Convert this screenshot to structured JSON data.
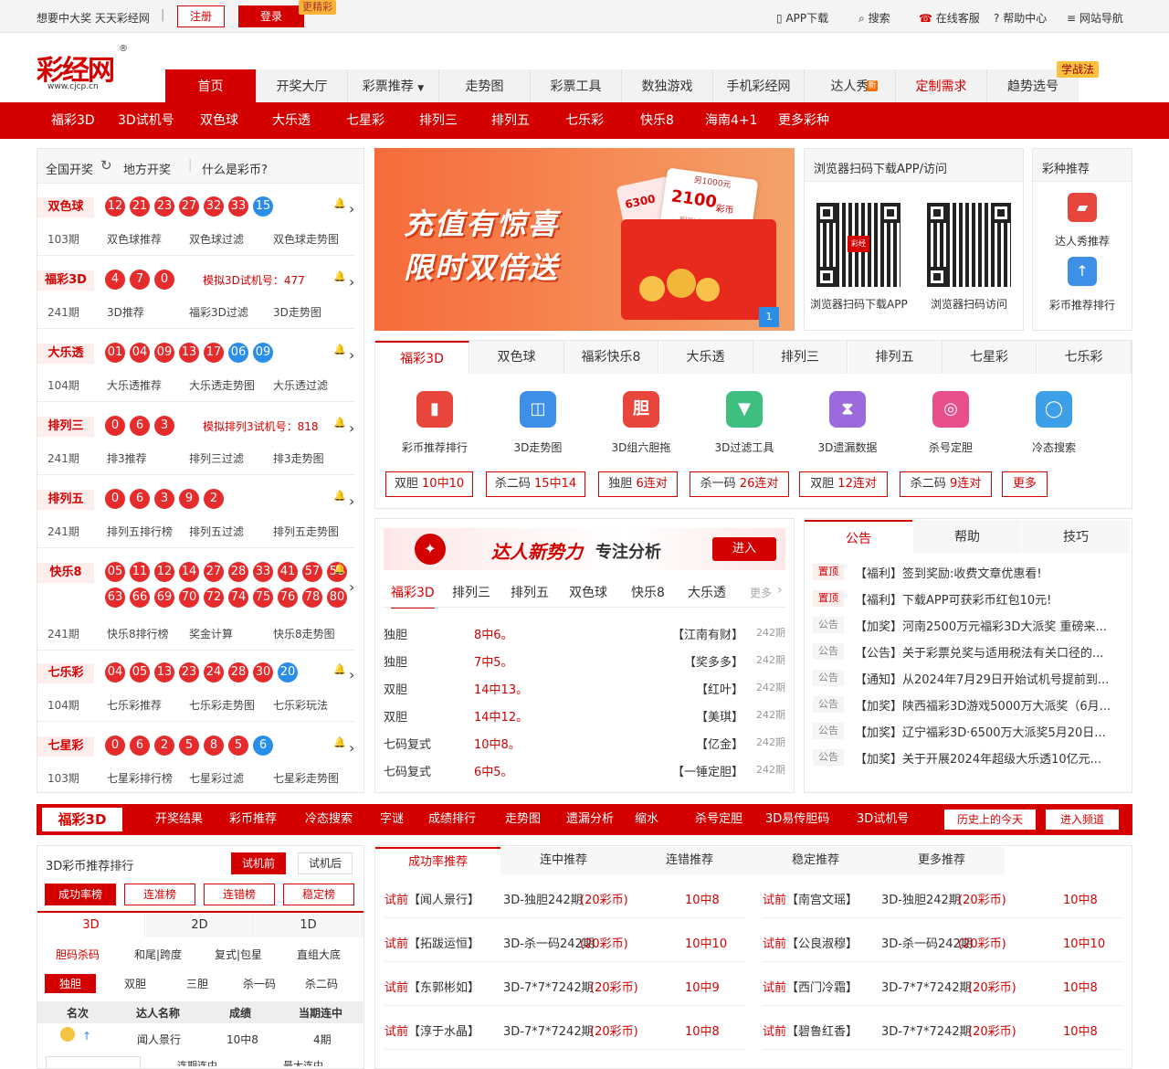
{
  "topbar": {
    "slogan": "想要中大奖 天天彩经网",
    "sep": "|",
    "register": "注册",
    "login": "登录",
    "login_tag": "更精彩",
    "links": [
      {
        "label": "APP下载",
        "icon": "phone-icon"
      },
      {
        "label": "搜索",
        "icon": "search-icon"
      },
      {
        "label": "在线客服",
        "icon": "service-icon"
      },
      {
        "label": "帮助中心",
        "icon": "help-icon"
      },
      {
        "label": "网站导航",
        "icon": "menu-icon"
      }
    ]
  },
  "logo": {
    "main": "彩经网",
    "url": "www.cjcp.cn",
    "reg": "®"
  },
  "main_nav": {
    "items": [
      "首页",
      "开奖大厅",
      "彩票推荐",
      "走势图",
      "彩票工具",
      "数独游戏",
      "手机彩经网",
      "达人秀",
      "定制需求",
      "趋势选号"
    ],
    "hot_badge": "新",
    "study_tag": "学战法"
  },
  "sub_nav": [
    "福彩3D",
    "3D试机号",
    "双色球",
    "大乐透",
    "七星彩",
    "排列三",
    "排列五",
    "七乐彩",
    "快乐8",
    "海南4+1",
    "更多彩种"
  ],
  "draw_panel": {
    "tabs": [
      "全国开奖",
      "地方开奖",
      "什么是彩币?"
    ],
    "rows": [
      {
        "name": "双色球",
        "balls": [
          "12",
          "21",
          "23",
          "27",
          "32",
          "33"
        ],
        "blue": [
          "15"
        ],
        "issue": "103期",
        "links": [
          "双色球推荐",
          "双色球过滤",
          "双色球走势图"
        ]
      },
      {
        "name": "福彩3D",
        "balls": [
          "4",
          "7",
          "0"
        ],
        "blue": [],
        "shiji": "模拟3D试机号：477",
        "issue": "241期",
        "links": [
          "3D推荐",
          "福彩3D过滤",
          "3D走势图"
        ]
      },
      {
        "name": "大乐透",
        "balls": [
          "01",
          "04",
          "09",
          "13",
          "17"
        ],
        "blue": [
          "06",
          "09"
        ],
        "issue": "104期",
        "links": [
          "大乐透推荐",
          "大乐透走势图",
          "大乐透过滤"
        ]
      },
      {
        "name": "排列三",
        "balls": [
          "0",
          "6",
          "3"
        ],
        "blue": [],
        "shiji": "模拟排列3试机号：818",
        "issue": "241期",
        "links": [
          "排3推荐",
          "排列三过滤",
          "排3走势图"
        ]
      },
      {
        "name": "排列五",
        "balls": [
          "0",
          "6",
          "3",
          "9",
          "2"
        ],
        "blue": [],
        "issue": "241期",
        "links": [
          "排列五排行榜",
          "排列五过滤",
          "排列五走势图"
        ]
      },
      {
        "name": "快乐8",
        "balls": [
          "05",
          "11",
          "12",
          "14",
          "27",
          "28",
          "33",
          "41",
          "57",
          "58",
          "63",
          "66",
          "69",
          "70",
          "72",
          "74",
          "75",
          "76",
          "78",
          "80"
        ],
        "blue": [],
        "issue": "241期",
        "links": [
          "快乐8排行榜",
          "奖金计算",
          "快乐8走势图"
        ]
      },
      {
        "name": "七乐彩",
        "balls": [
          "04",
          "05",
          "13",
          "23",
          "24",
          "28",
          "30"
        ],
        "blue": [
          "20"
        ],
        "issue": "104期",
        "links": [
          "七乐彩推荐",
          "七乐彩走势图",
          "七乐彩玩法"
        ]
      },
      {
        "name": "七星彩",
        "balls": [
          "0",
          "6",
          "2",
          "5",
          "8",
          "5"
        ],
        "blue": [
          "6"
        ],
        "issue": "103期",
        "links": [
          "七星彩排行榜",
          "七星彩过滤",
          "七星彩走势图"
        ]
      }
    ]
  },
  "banner": {
    "line1": "充值有惊喜",
    "line2": "限时双倍送",
    "card_big": "2100",
    "card_big_unit": "彩币",
    "card_small": "6300",
    "card_top": "另1000元",
    "card_note": "到账金额",
    "page": "1"
  },
  "qr_panel": {
    "title": "浏览器扫码下载APP/访问",
    "captions": [
      "浏览器扫码下载APP",
      "浏览器扫码访问"
    ],
    "qr_badge": "彩经"
  },
  "rec_panel": {
    "title": "彩种推荐",
    "items": [
      "达人秀推荐",
      "彩币推荐排行"
    ]
  },
  "tools": {
    "tabs": [
      "福彩3D",
      "双色球",
      "福彩快乐8",
      "大乐透",
      "排列三",
      "排列五",
      "七星彩",
      "七乐彩"
    ],
    "icons": [
      {
        "label": "彩币推荐排行",
        "glyph": "▮",
        "color": "#e8453c"
      },
      {
        "label": "3D走势图",
        "glyph": "◫",
        "color": "#3d8fe8"
      },
      {
        "label": "3D组六胆拖",
        "glyph": "胆",
        "color": "#e8453c"
      },
      {
        "label": "3D过滤工具",
        "glyph": "▼",
        "color": "#3fbf7f"
      },
      {
        "label": "3D遗漏数据",
        "glyph": "⧗",
        "color": "#9b6bde"
      },
      {
        "label": "杀号定胆",
        "glyph": "◎",
        "color": "#e84e8a"
      },
      {
        "label": "冷态搜索",
        "glyph": "◯",
        "color": "#3d9fe8"
      }
    ],
    "buttons": [
      {
        "k": "双胆",
        "v": "10中10"
      },
      {
        "k": "杀二码",
        "v": "15中14"
      },
      {
        "k": "独胆",
        "v": "6连对"
      },
      {
        "k": "杀一码",
        "v": "26连对"
      },
      {
        "k": "双胆",
        "v": "12连对"
      },
      {
        "k": "杀二码",
        "v": "9连对"
      },
      {
        "k": "更多",
        "v": ""
      }
    ]
  },
  "expert": {
    "slogan1": "达人新势力",
    "slogan2": "专注分析",
    "enter": "进入",
    "tabs": [
      "福彩3D",
      "排列三",
      "排列五",
      "双色球",
      "快乐8",
      "大乐透",
      "更多"
    ],
    "rows": [
      {
        "type": "独胆",
        "result": "8中6。",
        "name": "【江南有财】",
        "issue": "242期"
      },
      {
        "type": "独胆",
        "result": "7中5。",
        "name": "【奖多多】",
        "issue": "242期"
      },
      {
        "type": "双胆",
        "result": "14中13。",
        "name": "【红叶】",
        "issue": "242期"
      },
      {
        "type": "双胆",
        "result": "14中12。",
        "name": "【美琪】",
        "issue": "242期"
      },
      {
        "type": "七码复式",
        "result": "10中8。",
        "name": "【亿金】",
        "issue": "242期"
      },
      {
        "type": "七码复式",
        "result": "6中5。",
        "name": "【一锤定胆】",
        "issue": "242期"
      }
    ]
  },
  "notice": {
    "tabs": [
      "公告",
      "帮助",
      "技巧"
    ],
    "rows": [
      {
        "tag": "置顶",
        "text": "【福利】签到奖励:收费文章优惠看!"
      },
      {
        "tag": "置顶",
        "text": "【福利】下载APP可获彩币红包10元!"
      },
      {
        "tag": "公告",
        "text": "【加奖】河南2500万元福彩3D大派奖 重磅来..."
      },
      {
        "tag": "公告",
        "text": "【公告】关于彩票兑奖与适用税法有关口径的..."
      },
      {
        "tag": "公告",
        "text": "【通知】从2024年7月29日开始试机号提前到..."
      },
      {
        "tag": "公告",
        "text": "【加奖】陕西福彩3D游戏5000万大派奖（6月..."
      },
      {
        "tag": "公告",
        "text": "【加奖】辽宁福彩3D·6500万大派奖5月20日..."
      },
      {
        "tag": "公告",
        "text": "【加奖】关于开展2024年超级大乐透10亿元..."
      }
    ]
  },
  "bar3d": {
    "label": "福彩3D",
    "links": [
      "开奖结果",
      "彩币推荐",
      "冷态搜索",
      "字谜",
      "成绩排行",
      "走势图",
      "遗漏分析",
      "缩水",
      "杀号定胆",
      "3D易传胆码",
      "3D试机号"
    ],
    "btn_history": "历史上的今天",
    "btn_enter": "进入频道"
  },
  "rank": {
    "title": "3D彩币推荐排行",
    "toggle": [
      "试机前",
      "试机后"
    ],
    "filters": [
      "成功率榜",
      "连准榜",
      "连错榜",
      "稳定榜"
    ],
    "tabs": [
      "3D",
      "2D",
      "1D"
    ],
    "sub1": [
      "胆码杀码",
      "和尾|跨度",
      "复式|包星",
      "直组大底"
    ],
    "sub2": [
      "独胆",
      "双胆",
      "三胆",
      "杀一码",
      "杀二码"
    ],
    "headers": [
      "名次",
      "达人名称",
      "成绩",
      "当期连中"
    ],
    "row": {
      "rank_arrow": "↑",
      "name": "闻人景行",
      "score": "10中8",
      "streak": "4期"
    },
    "partial": [
      "连期连中",
      "最大连中"
    ]
  },
  "recommend": {
    "tabs": [
      "成功率推荐",
      "连中推荐",
      "连错推荐",
      "稳定推荐",
      "更多推荐"
    ],
    "left": [
      {
        "pre": "试前",
        "name": "【闻人景行】",
        "title": "3D-独胆242期",
        "price": "(20彩币)",
        "score": "10中8"
      },
      {
        "pre": "试前",
        "name": "【拓跋运恒】",
        "title": "3D-杀一码242期",
        "price": "(20彩币)",
        "score": "10中10"
      },
      {
        "pre": "试前",
        "name": "【东郭彬如】",
        "title": "3D-7*7*7242期",
        "price": "(20彩币)",
        "score": "10中9"
      },
      {
        "pre": "试前",
        "name": "【淳于水晶】",
        "title": "3D-7*7*7242期",
        "price": "(20彩币)",
        "score": "10中8"
      }
    ],
    "right": [
      {
        "pre": "试前",
        "name": "【南宫文瑶】",
        "title": "3D-独胆242期",
        "price": "(20彩币)",
        "score": "10中8"
      },
      {
        "pre": "试前",
        "name": "【公良淑穆】",
        "title": "3D-杀一码242期",
        "price": "(20彩币)",
        "score": "10中10"
      },
      {
        "pre": "试前",
        "name": "【西门冷霜】",
        "title": "3D-7*7*7242期",
        "price": "(20彩币)",
        "score": "10中8"
      },
      {
        "pre": "试前",
        "name": "【碧鲁红香】",
        "title": "3D-7*7*7242期",
        "price": "(20彩币)",
        "score": "10中8"
      }
    ]
  }
}
